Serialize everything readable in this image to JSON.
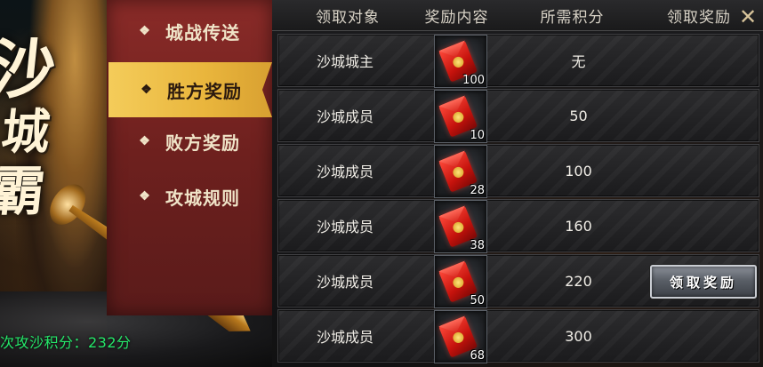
{
  "left_panel": {
    "calligraphy": [
      "沙",
      "城",
      "霸"
    ],
    "score_text": "次攻沙积分：232分"
  },
  "menu": {
    "items": [
      {
        "label": "城战传送",
        "active": false
      },
      {
        "label": "胜方奖励",
        "active": true
      },
      {
        "label": "败方奖励",
        "active": false
      },
      {
        "label": "攻城规则",
        "active": false
      }
    ]
  },
  "table": {
    "headers": [
      "领取对象",
      "奖励内容",
      "所需积分",
      "领取奖励"
    ],
    "rows": [
      {
        "target": "沙城城主",
        "reward_icon": "red-envelope-icon",
        "reward_qty": "100",
        "points": "无",
        "claim_label": ""
      },
      {
        "target": "沙城成员",
        "reward_icon": "red-envelope-icon",
        "reward_qty": "10",
        "points": "50",
        "claim_label": ""
      },
      {
        "target": "沙城成员",
        "reward_icon": "red-envelope-icon",
        "reward_qty": "28",
        "points": "100",
        "claim_label": ""
      },
      {
        "target": "沙城成员",
        "reward_icon": "red-envelope-icon",
        "reward_qty": "38",
        "points": "160",
        "claim_label": ""
      },
      {
        "target": "沙城成员",
        "reward_icon": "red-envelope-icon",
        "reward_qty": "50",
        "points": "220",
        "claim_label": "领取奖励"
      },
      {
        "target": "沙城成员",
        "reward_icon": "red-envelope-icon",
        "reward_qty": "68",
        "points": "300",
        "claim_label": ""
      }
    ]
  },
  "colors": {
    "menu_active": "#f4cc5a",
    "menu_bg": "#7a2523",
    "score_green": "#25e86a"
  }
}
